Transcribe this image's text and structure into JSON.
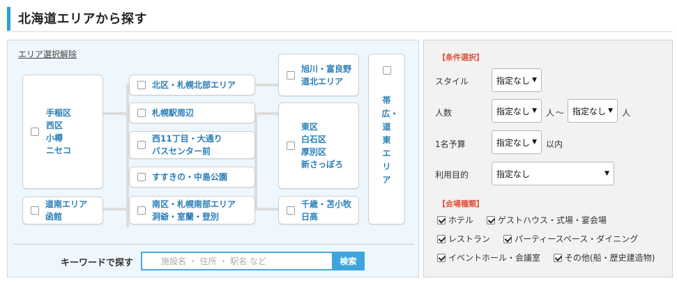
{
  "header": {
    "title": "北海道エリアから探す"
  },
  "map": {
    "clear_label": "エリア選択解除",
    "areas": {
      "teine": "手稲区\n西区\n小樽\nニセコ",
      "dounan": "道南エリア\n函館",
      "kita": "北区・札幌北部エリア",
      "sapporo_eki": "札幌駅周辺",
      "nishi11": "西11丁目・大通り\nバスセンター前",
      "susukino": "すすきの・中島公園",
      "minami": "南区・札幌南部エリア\n洞爺・室蘭・登別",
      "asahikawa": "旭川・富良野\n道北エリア",
      "higashi": "東区\n白石区\n厚別区\n新さっぽろ",
      "chitose": "千歳・苫小牧\n日高",
      "obihiro": "帯広・道東エリア"
    }
  },
  "keyword": {
    "label": "キーワードで探す",
    "placeholder": "施設名 ・ 住所 ・ 駅名 など",
    "button": "検索"
  },
  "conditions": {
    "title": "【条件選択】",
    "style_label": "スタイル",
    "style_value": "指定なし",
    "people_label": "人数",
    "people_min": "指定なし",
    "people_unit1": "人",
    "tilde": "～",
    "people_max": "指定なし",
    "people_unit2": "人",
    "budget_label": "1名予算",
    "budget_value": "指定なし",
    "budget_unit": "以内",
    "purpose_label": "利用目的",
    "purpose_value": "指定なし",
    "arrow": "▼"
  },
  "venue": {
    "title": "【会場種類】",
    "types": [
      "ホテル",
      "ゲストハウス・式場・宴会場",
      "レストラン",
      "パーティースペース・ダイニング",
      "イベントホール・会議室",
      "その他(船・歴史建造物)"
    ]
  }
}
